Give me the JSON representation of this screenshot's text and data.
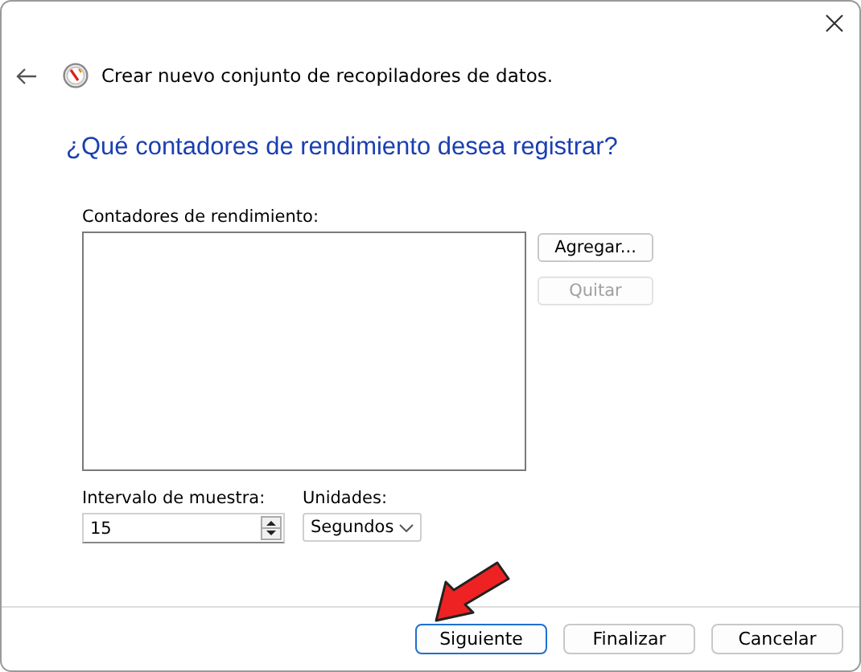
{
  "header": {
    "title": "Crear nuevo conjunto de recopiladores de datos."
  },
  "heading": "¿Qué contadores de rendimiento desea registrar?",
  "counters": {
    "label": "Contadores de rendimiento:",
    "items_buttons": [
      {
        "label": "Agregar...",
        "disabled": false
      },
      {
        "label": "Quitar",
        "disabled": true
      }
    ]
  },
  "interval": {
    "label": "Intervalo de muestra:",
    "value": "15"
  },
  "units": {
    "label": "Unidades:",
    "value": "Segundos"
  },
  "footer_buttons": [
    {
      "label": "Siguiente",
      "default": true
    },
    {
      "label": "Finalizar",
      "default": false
    },
    {
      "label": "Cancelar",
      "default": false
    }
  ]
}
